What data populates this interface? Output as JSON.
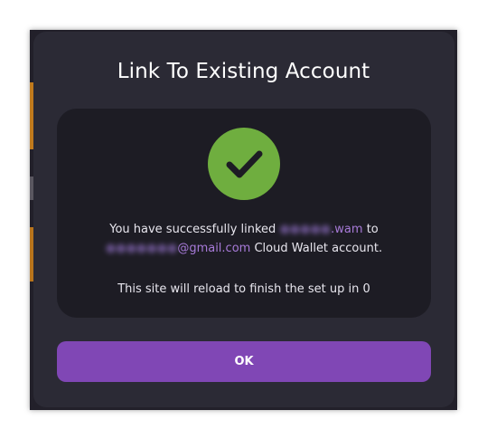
{
  "dialog": {
    "title": "Link To Existing Account",
    "message": {
      "line1_prefix": "You have successfully linked ",
      "account_redacted": "●●●●●",
      "account_suffix": ".wam",
      "line1_suffix": " to",
      "email_redacted": "●●●●●●●",
      "email_domain": "@gmail.com",
      "line2_suffix": " Cloud Wallet account.",
      "reload_text": "This site will reload to finish the set up in 0"
    },
    "ok_label": "OK"
  },
  "icons": {
    "status_icon": "check-icon"
  },
  "colors": {
    "modal_bg": "#2b2a35",
    "card_bg": "#1d1c24",
    "success": "#6fae3f",
    "accent": "#a77ad8",
    "button": "#8047b5"
  }
}
